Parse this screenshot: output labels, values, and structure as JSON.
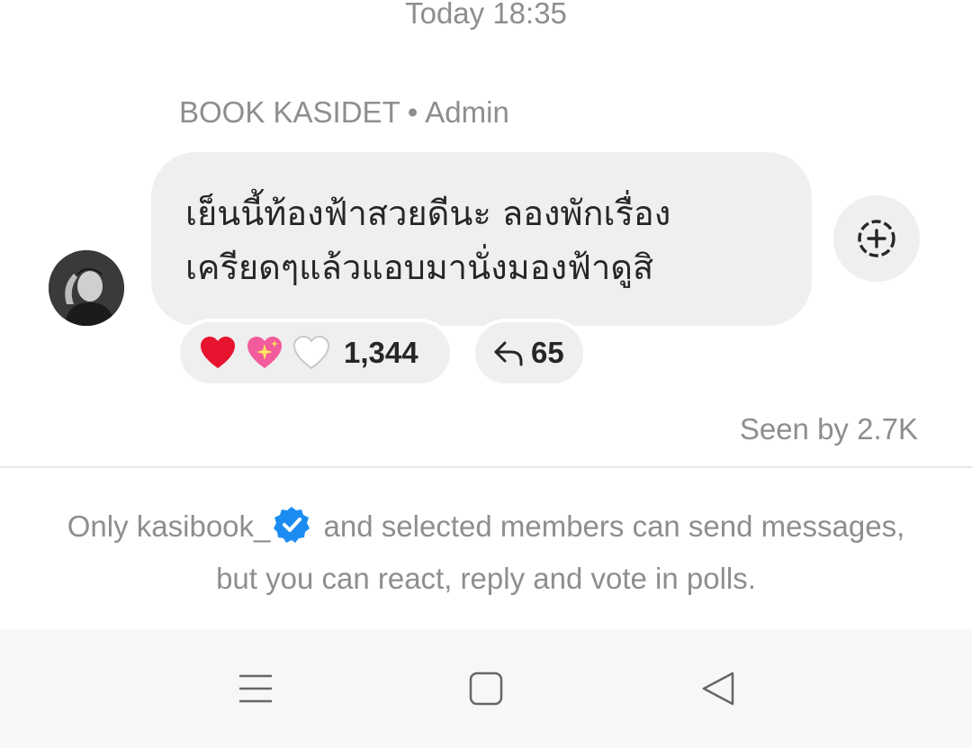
{
  "chat": {
    "timestamp": "Today 18:35",
    "sender": {
      "name": "BOOK KASIDET",
      "separator": "•",
      "role": "Admin"
    },
    "message": {
      "text": "เย็นนี้ท้องฟ้าสวยดีนะ ลองพักเรื่อง\nเครียดๆแล้วแอบมานั่งมองฟ้าดูสิ"
    },
    "reactions": {
      "emojis": [
        "red-heart",
        "sparkling-heart",
        "white-heart"
      ],
      "count": "1,344"
    },
    "replies": {
      "count": "65"
    },
    "seen": "Seen by 2.7K"
  },
  "notice": {
    "prefix": "Only kasibook_",
    "suffix": " and selected members can send messages, but you can react, reply and vote in polls."
  },
  "colors": {
    "bubble": "#efefef",
    "muted_text": "#8e8e8e",
    "verified_blue": "#1d8cf2",
    "heart_red": "#e8132f",
    "heart_pink": "#f25c9c"
  },
  "icons": {
    "react_button": "add-reaction-icon",
    "reply": "reply-arrow-icon",
    "verified": "verified-badge-icon",
    "nav": [
      "menu-icon",
      "home-square-icon",
      "back-triangle-icon"
    ]
  }
}
